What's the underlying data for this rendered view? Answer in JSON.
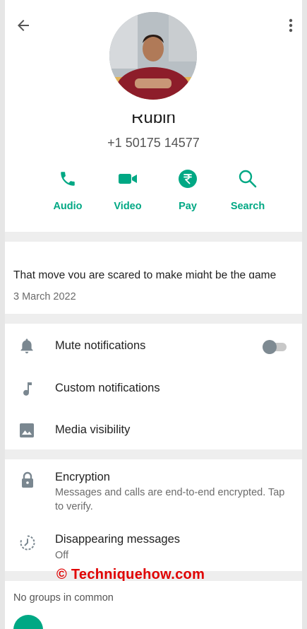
{
  "contact": {
    "name": "Rubin",
    "phone": "+1 50175 14577"
  },
  "actions": [
    {
      "label": "Audio",
      "icon": "phone-icon"
    },
    {
      "label": "Video",
      "icon": "video-camera-icon"
    },
    {
      "label": "Pay",
      "icon": "rupee-icon"
    },
    {
      "label": "Search",
      "icon": "search-icon"
    }
  ],
  "about": {
    "status": "That move you are scared to make might be the game changer.",
    "date": "3 March 2022"
  },
  "settings": {
    "mute": {
      "label": "Mute notifications",
      "enabled": false
    },
    "custom": {
      "label": "Custom notifications"
    },
    "media": {
      "label": "Media visibility"
    }
  },
  "security": {
    "encryption": {
      "title": "Encryption",
      "desc": "Messages and calls are end-to-end encrypted. Tap to verify."
    },
    "disappearing": {
      "title": "Disappearing messages",
      "value": "Off"
    }
  },
  "groups": {
    "label": "No groups in common"
  },
  "watermark": "© Techniquehow.com",
  "colors": {
    "accent": "#00a884",
    "icon_gray": "#7a8790",
    "watermark": "#e00000"
  }
}
